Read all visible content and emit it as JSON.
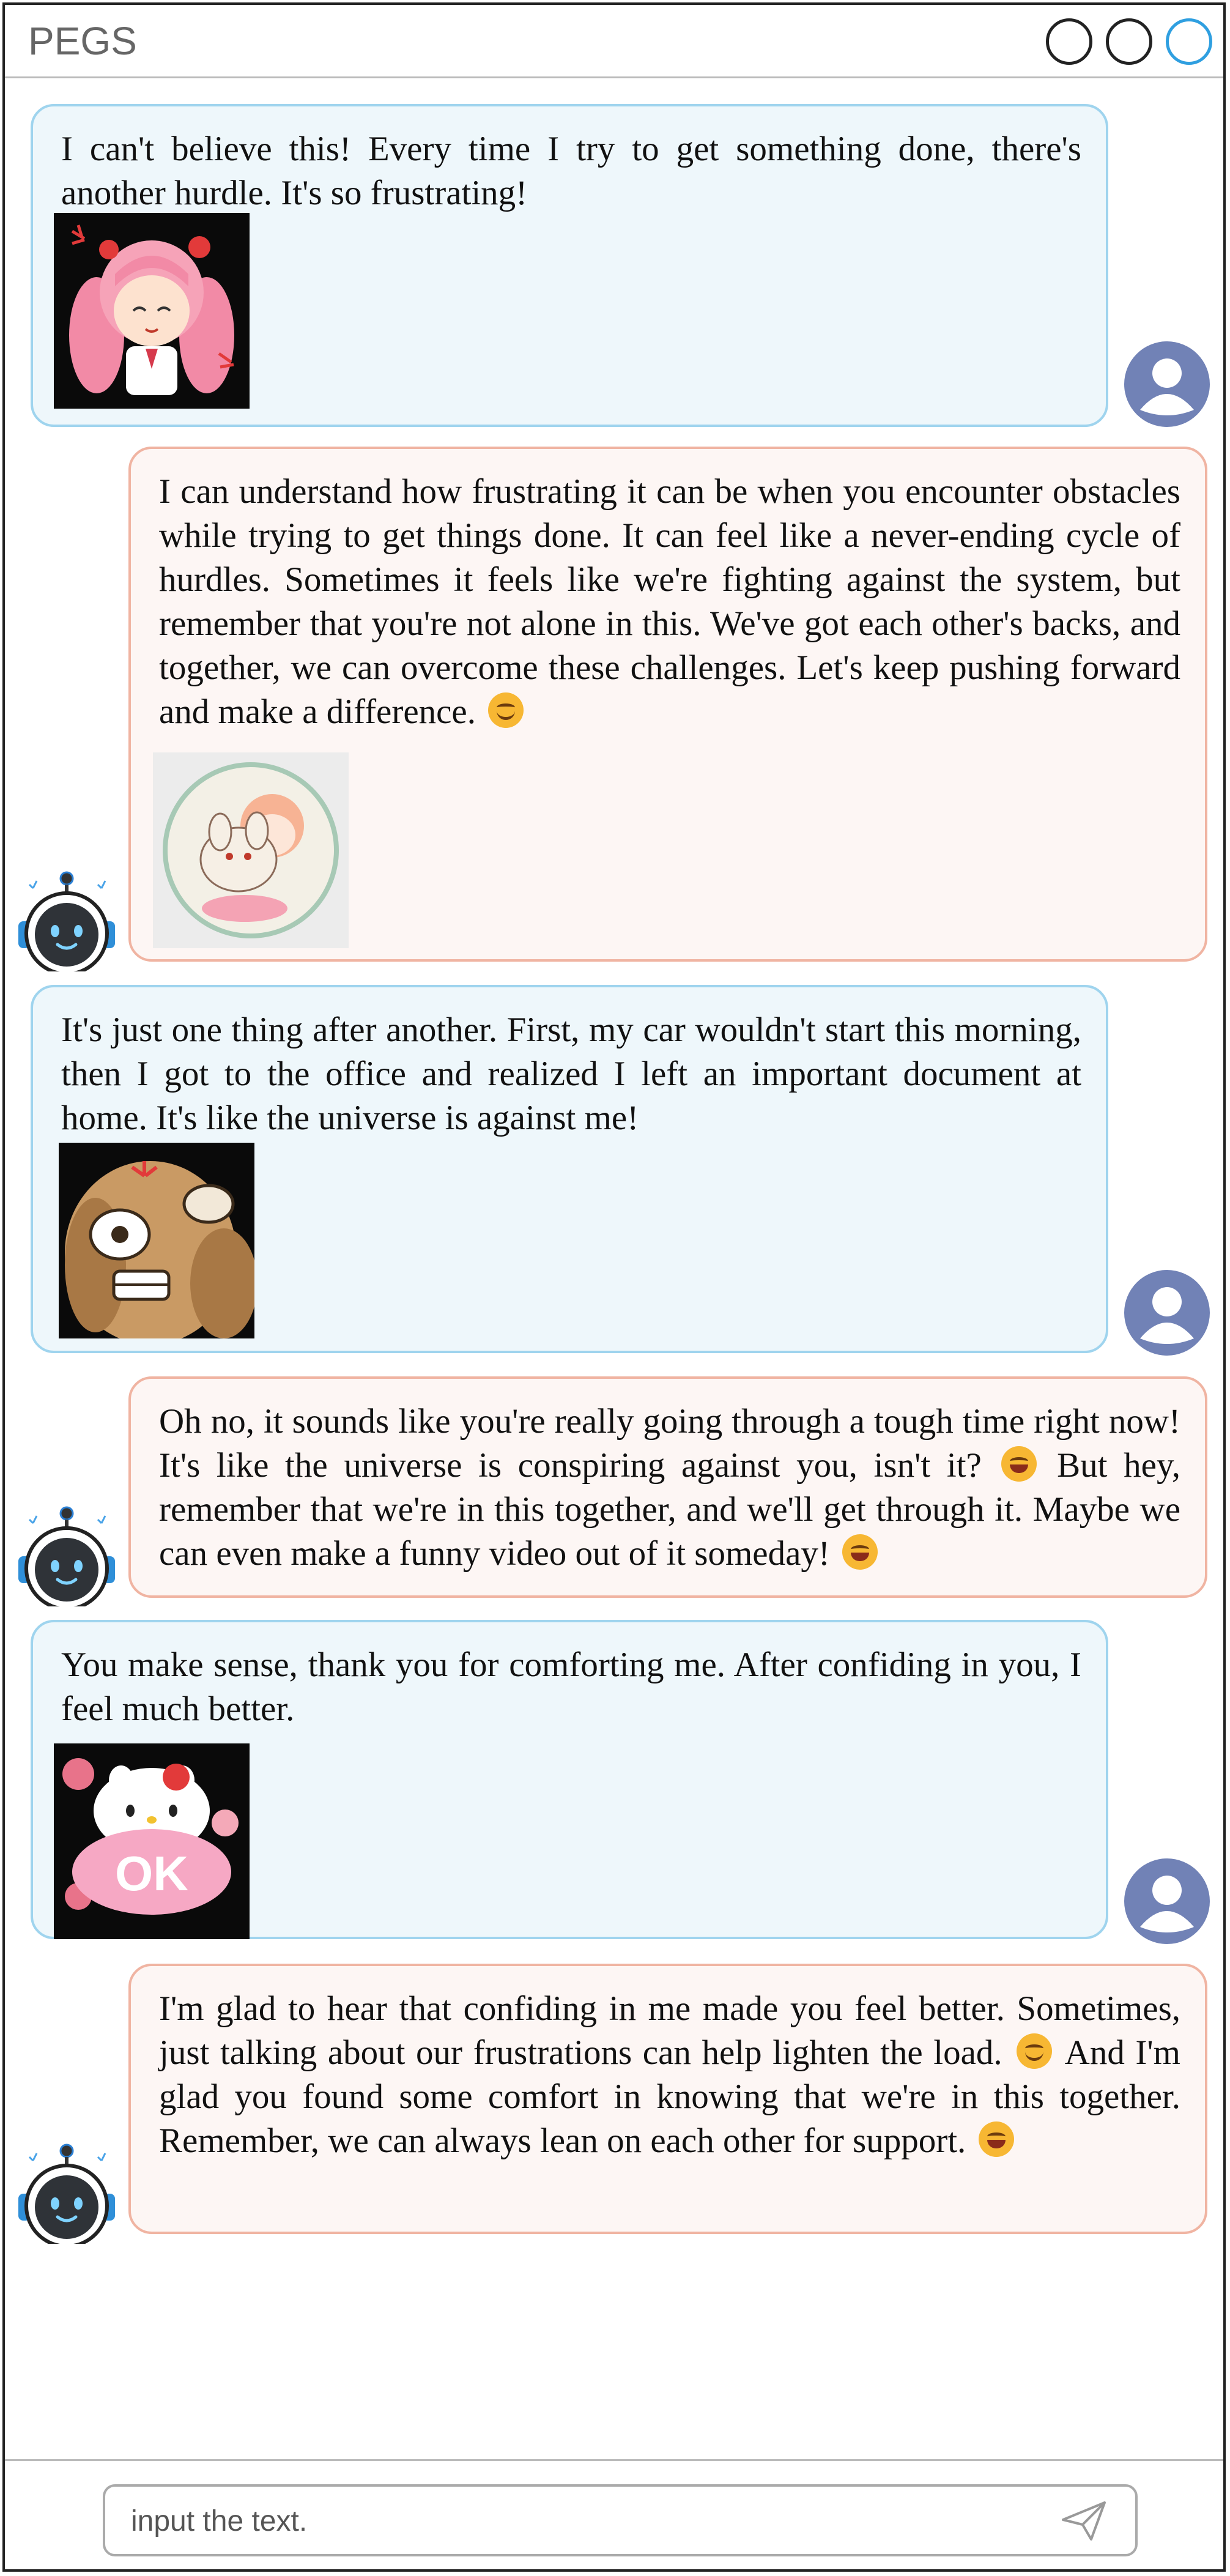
{
  "app": {
    "title": "PEGS"
  },
  "colors": {
    "user_bubble_bg": "#eef7fb",
    "user_bubble_border": "#9fd4ee",
    "bot_bubble_bg": "#fdf6f4",
    "bot_bubble_border": "#f0b4a2",
    "user_avatar": "#7182b6",
    "active_window_button": "#2f9fe0"
  },
  "messages": [
    {
      "role": "user",
      "text": "I can't believe this! Every time I try to get something done, there's another hurdle. It's so frustrating!",
      "sticker": "angry-pink-haired-girl-sticker"
    },
    {
      "role": "bot",
      "text": "I can understand how frustrating it can be when you encounter obstacles while trying to get things done. It can feel like a never-ending cycle of hurdles. Sometimes it feels like we're fighting against the system, but remember that you're not alone in this. We've got each other's backs, and together, we can overcome these challenges. Let's keep pushing forward and make a difference.",
      "emojis": [
        "smiling-face-emoji"
      ],
      "sticker": "girl-hugging-plush-sticker"
    },
    {
      "role": "user",
      "text": "It's just one thing after another. First, my car wouldn't start this morning, then I got to the office and realized I left an important document at home. It's like the universe is against me!",
      "sticker": "frustrated-dog-sticker"
    },
    {
      "role": "bot",
      "text_parts": [
        "Oh no, it sounds like you're really going through a tough time right now! It's like the universe is conspiring against you, isn't it?",
        "But hey, remember that we're in this together, and we'll get through it. Maybe we can even make a funny video out of it someday!"
      ],
      "emojis": [
        "sweat-smile-emoji",
        "grinning-face-emoji"
      ]
    },
    {
      "role": "user",
      "text": "You make sense, thank you for comforting me. After confiding in you, I feel much better.",
      "sticker": "hello-kitty-ok-sticker",
      "sticker_text": "OK"
    },
    {
      "role": "bot",
      "text_parts": [
        "I'm glad to hear that confiding in me made you feel better. Sometimes, just talking about our frustrations can help lighten the load.",
        "And I'm glad you found some comfort in knowing that we're in this together. Remember, we can always lean on each other for support."
      ],
      "emojis": [
        "smiling-face-emoji",
        "grinning-face-emoji"
      ]
    }
  ],
  "input": {
    "placeholder": "input the text."
  },
  "icons": {
    "user_avatar": "user-avatar-icon",
    "bot_avatar": "robot-avatar-icon",
    "send": "send-icon"
  }
}
